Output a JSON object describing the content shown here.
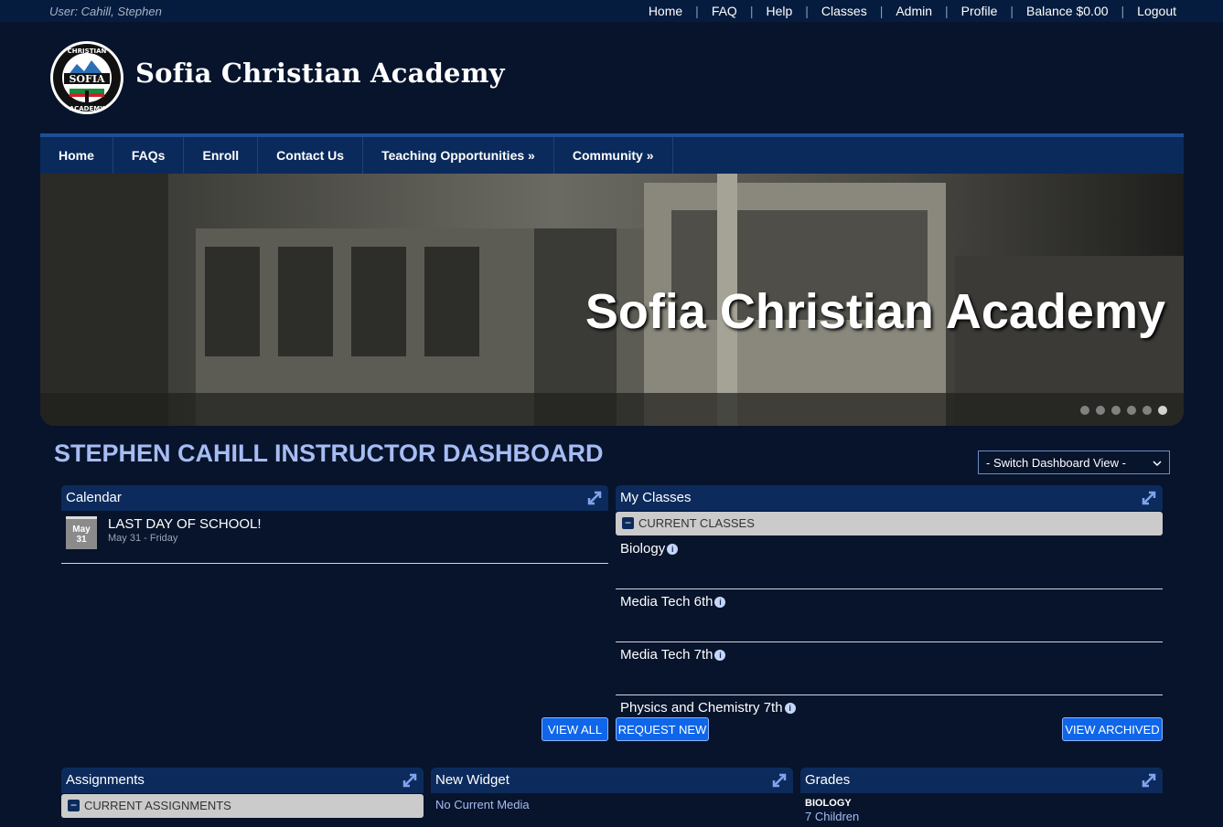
{
  "topbar": {
    "user": "User: Cahill, Stephen",
    "links": [
      "Home",
      "FAQ",
      "Help",
      "Classes",
      "Admin",
      "Profile",
      "Balance $0.00",
      "Logout"
    ]
  },
  "header": {
    "title": "Sofia Christian Academy",
    "logo_text": {
      "top": "CHRISTIAN",
      "center": "SOFIA",
      "bottom": "ACADEMY"
    }
  },
  "nav": [
    "Home",
    "FAQs",
    "Enroll",
    "Contact Us",
    "Teaching Opportunities »",
    "Community »"
  ],
  "hero": {
    "title": "Sofia Christian Academy",
    "slides": 6,
    "active_slide": 6
  },
  "dashboard": {
    "title": "STEPHEN CAHILL INSTRUCTOR DASHBOARD",
    "switch_label": "- Switch Dashboard View -"
  },
  "calendar": {
    "title": "Calendar",
    "event": {
      "month": "May",
      "day": "31",
      "title": "LAST DAY OF SCHOOL!",
      "subtitle": "May 31 - Friday"
    },
    "view_all": "VIEW ALL"
  },
  "my_classes": {
    "title": "My Classes",
    "section": "CURRENT CLASSES",
    "classes": [
      "Biology",
      "Media Tech 6th",
      "Media Tech 7th",
      "Physics and Chemistry 7th"
    ],
    "request_new": "REQUEST NEW",
    "view_archived": "VIEW ARCHIVED"
  },
  "assignments": {
    "title": "Assignments",
    "section": "CURRENT ASSIGNMENTS"
  },
  "new_widget": {
    "title": "New Widget",
    "message": "No Current Media"
  },
  "grades": {
    "title": "Grades",
    "class": "BIOLOGY",
    "children": "7 Children"
  },
  "colors": {
    "background": "#07142b",
    "nav": "#0a2a5c",
    "accent": "#a7bcf4",
    "button": "#0f66e9"
  },
  "icons": [
    "expand-icon",
    "info-icon",
    "minus-icon",
    "chevron-down-icon"
  ]
}
